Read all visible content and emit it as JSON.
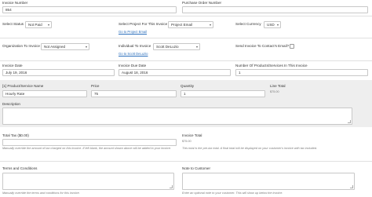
{
  "invoice_number": {
    "label": "Invoice Number",
    "value": "854"
  },
  "purchase_order": {
    "label": "Purchase Order Number",
    "value": ""
  },
  "status": {
    "label": "Select Status",
    "value": "Not Paid"
  },
  "project": {
    "label": "Select Project For This Invoice",
    "value": "Project Email",
    "link": "Go to Project Email"
  },
  "currency": {
    "label": "Select Currency",
    "value": "USD"
  },
  "organization": {
    "label": "Organization To Invoice",
    "value": "Not Assigned"
  },
  "individual": {
    "label": "Individual To Invoice",
    "value": "Scott DeLuzio",
    "link": "Go to Scott DeLuzio"
  },
  "send_invoice": {
    "label": "Send Invoice To Contact's Email?"
  },
  "invoice_date": {
    "label": "Invoice Date",
    "value": "July 19, 2016"
  },
  "invoice_due_date": {
    "label": "Invoice Due Date",
    "value": "August 18, 2016"
  },
  "num_products": {
    "label": "Number Of Products/Services In This Invoice",
    "value": "1"
  },
  "line_item": {
    "product_label": "[1] Product/Service Name",
    "product_value": "Hourly Rate",
    "price_label": "Price",
    "price_value": "75",
    "quantity_label": "Quantity",
    "quantity_value": "1",
    "line_total_label": "Line Total",
    "line_total_value": "$75.00",
    "description_label": "Description"
  },
  "total_tax": {
    "label": "Total Tax ($0.00)",
    "hint": "Manually override the amount of tax charged on this invoice. If left blank, the amount shown above will be added to your invoice."
  },
  "invoice_total": {
    "label": "Invoice Total",
    "value": "$75.00",
    "hint": "This total is the pre-tax total. A final total will be displayed on your customer's invoice with tax included."
  },
  "terms": {
    "label": "Terms and Conditions",
    "hint": "Manually override the terms and conditions for this invoice."
  },
  "note": {
    "label": "Note to Customer",
    "hint": "Enter an optional note to your customer. This will show up below the invoice."
  }
}
